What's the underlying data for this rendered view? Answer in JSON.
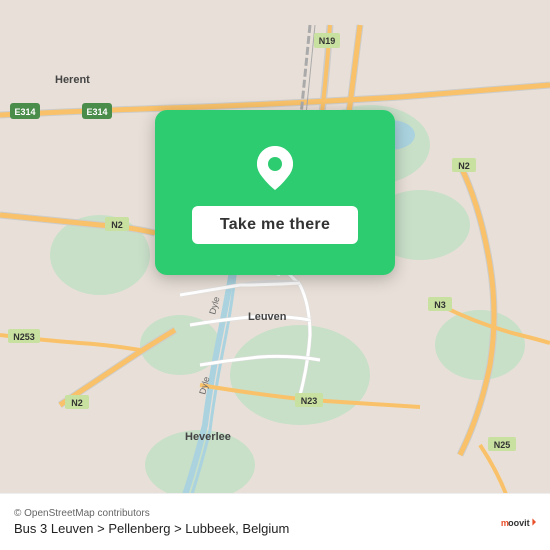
{
  "map": {
    "attribution": "© OpenStreetMap contributors",
    "center_city": "Leuven",
    "country": "Belgium"
  },
  "action_card": {
    "button_label": "Take me there"
  },
  "bottom_bar": {
    "osm_credit": "© OpenStreetMap contributors",
    "route_label": "Bus 3 Leuven > Pellenberg > Lubbeek, Belgium"
  },
  "moovit": {
    "logo_text": "moovit"
  },
  "road_labels": {
    "e314_north": "E314",
    "e314_west": "E314",
    "n19": "N19",
    "n2_east": "N2",
    "n2_west": "N2",
    "n2_sw": "N2",
    "n3": "N3",
    "n23": "N23",
    "n25": "N25",
    "n253": "N253",
    "herent": "Herent",
    "leuven": "Leuven",
    "heverlee": "Heverlee",
    "dyle1": "Dyle",
    "dyle2": "Dyle"
  }
}
